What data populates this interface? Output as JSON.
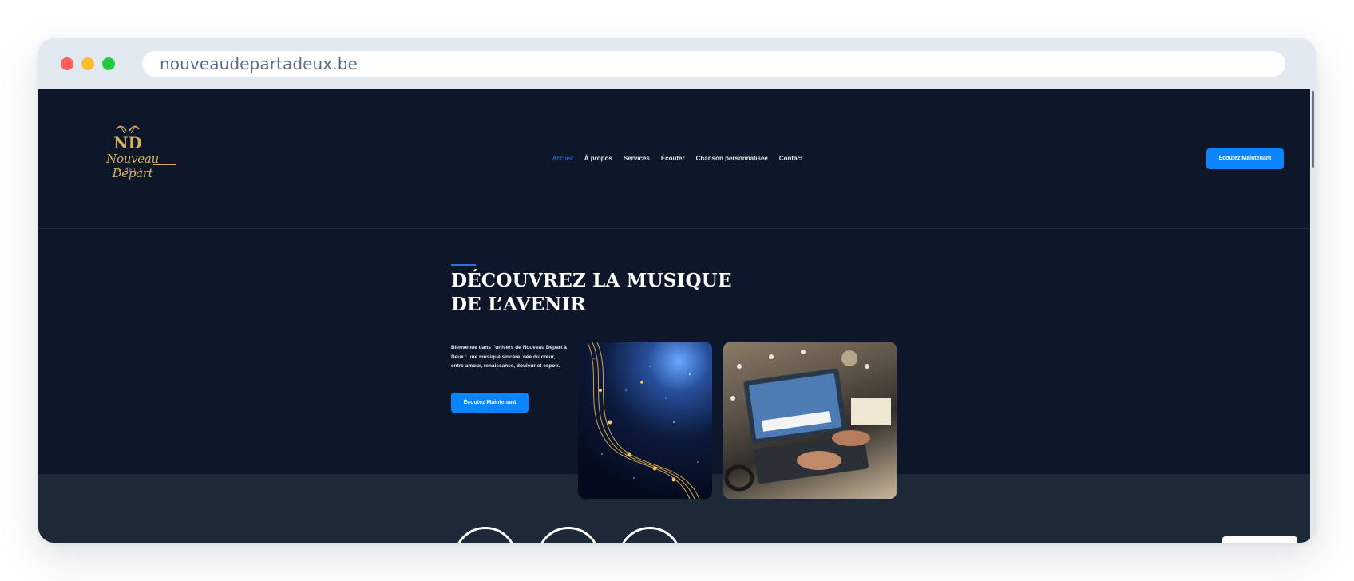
{
  "browser": {
    "url": "nouveaudepartadeux.be"
  },
  "logo": {
    "monogram": "ND",
    "name": "Nouveau Départ",
    "sub": "À DEUX"
  },
  "nav": {
    "items": [
      {
        "label": "Accueil",
        "active": true
      },
      {
        "label": "À propos",
        "active": false
      },
      {
        "label": "Services",
        "active": false
      },
      {
        "label": "Écouter",
        "active": false
      },
      {
        "label": "Chanson personnalisée",
        "active": false
      },
      {
        "label": "Contact",
        "active": false
      }
    ],
    "cta_label": "Écoutez Maintenant"
  },
  "hero": {
    "title": "DÉCOUVREZ LA MUSIQUE DE L’AVENIR",
    "text": "Bienvenue dans l’univers de Nouveau Départ à Deux : une musique sincère, née du cœur, entre amour, renaissance, douleur et espoir.",
    "cta_label": "Écoutez Maintenant"
  },
  "images": [
    {
      "name": "golden-music-notes-galaxy-image"
    },
    {
      "name": "laptop-music-production-image"
    }
  ],
  "colors": {
    "page_bg": "#0e1729",
    "section_bg": "#1e2937",
    "accent": "#0b84ff",
    "gold": "#d6b25e"
  }
}
